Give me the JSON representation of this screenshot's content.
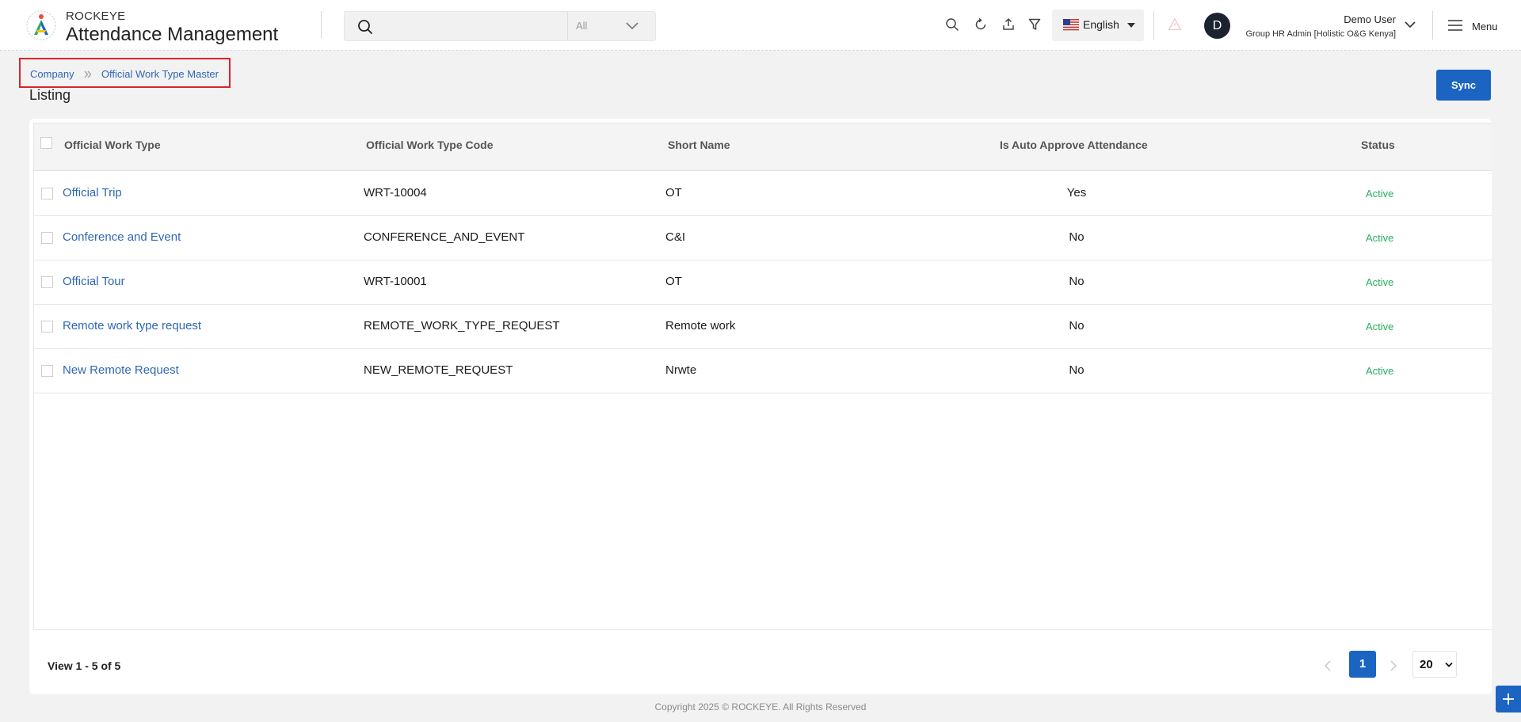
{
  "header": {
    "brand_top": "ROCKEYE",
    "brand_main": "Attendance Management",
    "search": {
      "placeholder": "",
      "scope": "All"
    },
    "language": "English",
    "user": {
      "initial": "D",
      "name": "Demo User",
      "role": "Group HR Admin [Holistic O&G Kenya]"
    },
    "menu_label": "Menu"
  },
  "breadcrumb": {
    "company": "Company",
    "current": "Official Work Type Master"
  },
  "page_title": "Listing",
  "sync_label": "Sync",
  "table": {
    "columns": [
      "Official Work Type",
      "Official Work Type Code",
      "Short Name",
      "Is Auto Approve Attendance",
      "Status"
    ],
    "rows": [
      {
        "name": "Official Trip",
        "code": "WRT-10004",
        "short": "OT",
        "auto": "Yes",
        "status": "Active"
      },
      {
        "name": "Conference and Event",
        "code": "CONFERENCE_AND_EVENT",
        "short": "C&I",
        "auto": "No",
        "status": "Active"
      },
      {
        "name": "Official Tour",
        "code": "WRT-10001",
        "short": "OT",
        "auto": "No",
        "status": "Active"
      },
      {
        "name": "Remote work type request",
        "code": "REMOTE_WORK_TYPE_REQUEST",
        "short": "Remote work",
        "auto": "No",
        "status": "Active"
      },
      {
        "name": "New Remote Request",
        "code": "NEW_REMOTE_REQUEST",
        "short": "Nrwte",
        "auto": "No",
        "status": "Active"
      }
    ]
  },
  "pagination": {
    "summary": "View 1 - 5 of 5",
    "current_page": "1",
    "page_size": "20"
  },
  "copyright": "Copyright 2025 © ROCKEYE. All Rights Reserved",
  "colors": {
    "primary": "#1b64c2",
    "link": "#2f67b5",
    "active": "#27ae60",
    "highlight": "#e0212a"
  }
}
